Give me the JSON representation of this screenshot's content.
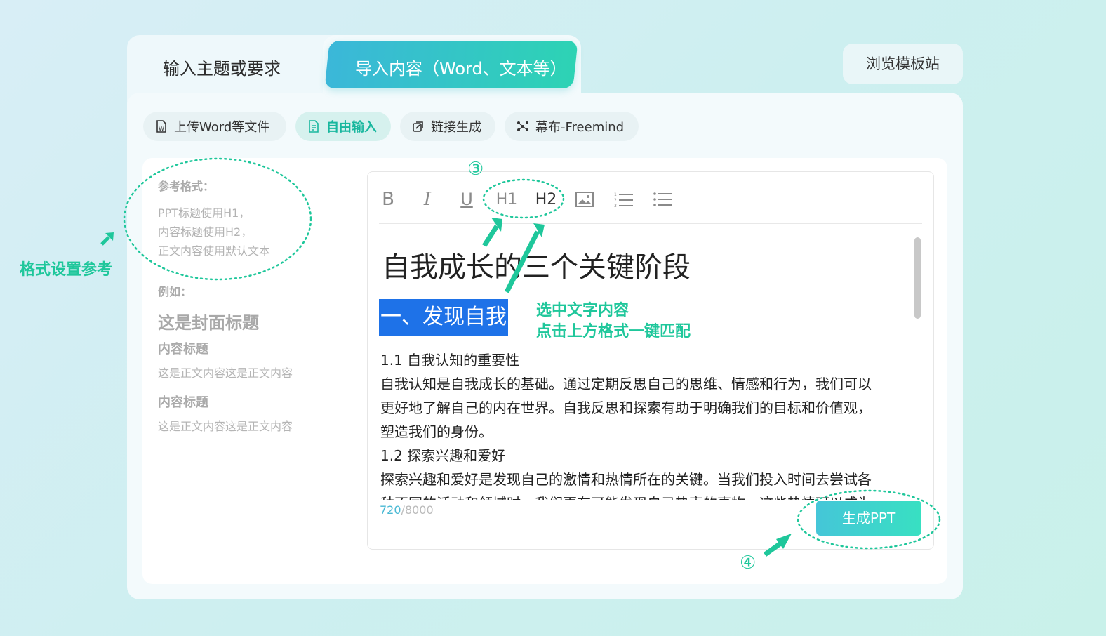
{
  "tabs": {
    "left_label": "输入主题或要求",
    "active_label": "导入内容（Word、文本等）",
    "browse_label": "浏览模板站"
  },
  "subtabs": [
    {
      "label": "上传Word等文件",
      "icon": "word-file-icon"
    },
    {
      "label": "自由输入",
      "icon": "document-icon"
    },
    {
      "label": "链接生成",
      "icon": "link-icon"
    },
    {
      "label": "幕布-Freemind",
      "icon": "mindmap-icon"
    }
  ],
  "reference": {
    "title": "参考格式：",
    "lines": [
      "PPT标题使用H1，",
      "内容标题使用H2，",
      "正文内容使用默认文本"
    ],
    "example": "例如：",
    "cover": "这是封面标题",
    "h2a": "内容标题",
    "body_a": "这是正文内容这是正文内容",
    "h2b": "内容标题",
    "body_b": "这是正文内容这是正文内容"
  },
  "annotations": {
    "format_ref": "格式设置参考",
    "select_tip_1": "选中文字内容",
    "select_tip_2": "点击上方格式一键匹配",
    "step3": "③",
    "step4": "④"
  },
  "toolbar": {
    "bold": "B",
    "italic": "I",
    "underline": "U",
    "h1": "H1",
    "h2": "H2"
  },
  "doc": {
    "h1": "自我成长的三个关键阶段",
    "h2": "一、发现自我",
    "body": [
      "1.1 自我认知的重要性",
      "自我认知是自我成长的基础。通过定期反思自己的思维、情感和行为，我们可以",
      "更好地了解自己的内在世界。自我反思和探索有助于明确我们的目标和价值观，",
      "塑造我们的身份。",
      "1.2 探索兴趣和爱好",
      "探索兴趣和爱好是发现自己的激情和热情所在的关键。当我们投入时间去尝试各",
      "种不同的活动和领域时，我们更有可能发现自己热衷的事物。这些热情可以成为"
    ]
  },
  "counter": {
    "current": "720",
    "max": "/8000"
  },
  "generate_label": "生成PPT",
  "colors": {
    "accent": "#1fc79b",
    "tab_gradient_start": "#3bb7d9",
    "tab_gradient_end": "#2dd3b4",
    "selection": "#1e72e8"
  }
}
